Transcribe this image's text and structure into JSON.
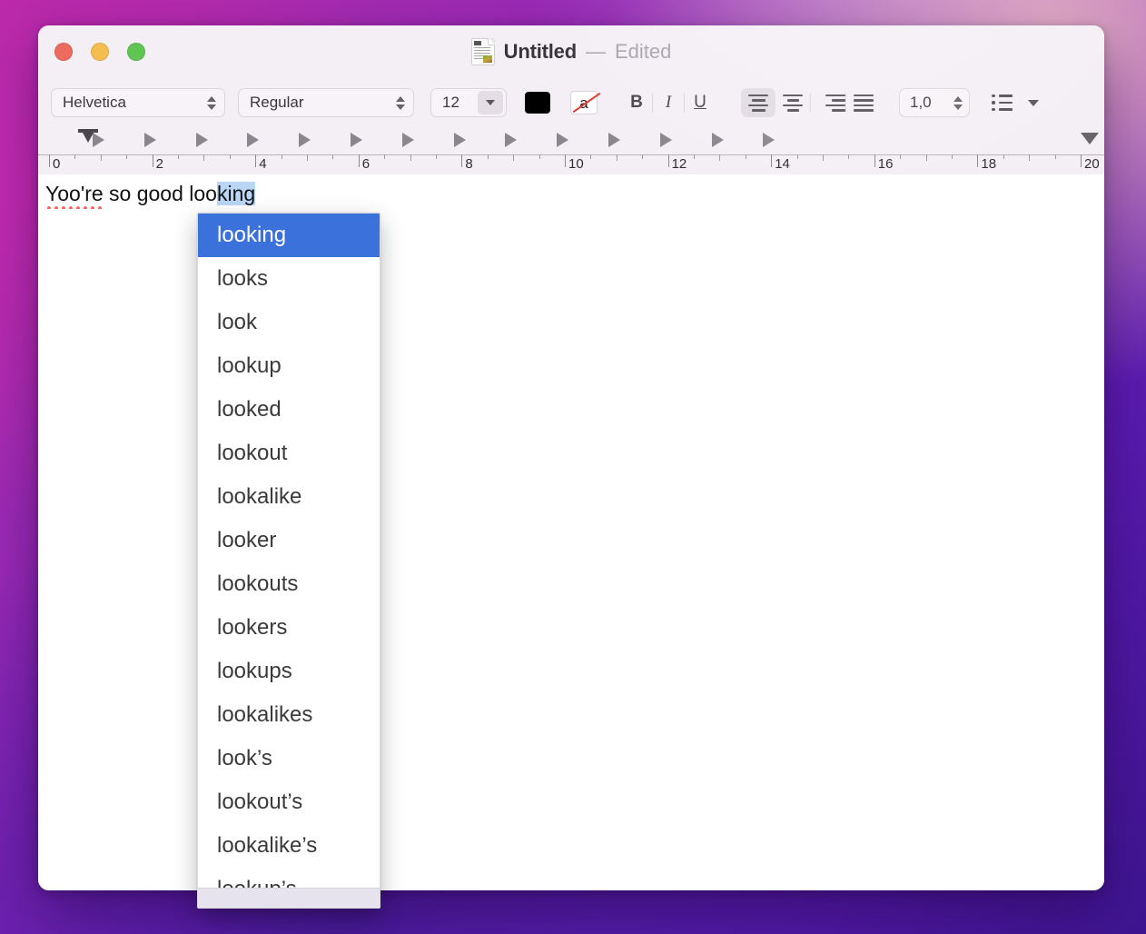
{
  "window": {
    "title": "Untitled",
    "separator": "—",
    "edited_label": "Edited",
    "doc_icon": "textedit-document-icon",
    "traffic_lights": {
      "close": "close-button",
      "minimize": "minimize-button",
      "zoom": "zoom-button"
    }
  },
  "toolbar": {
    "font_family": "Helvetica",
    "font_style": "Regular",
    "font_size": "12",
    "text_color": "#000000",
    "highlight_label": "a",
    "bold_label": "B",
    "italic_label": "I",
    "underline_label": "U",
    "line_spacing": "1,0",
    "active_alignment": "left",
    "accent_selected": "#e2dbe4"
  },
  "ruler": {
    "unit_labels": [
      "0",
      "2",
      "4",
      "6",
      "8",
      "10",
      "12",
      "14",
      "16",
      "18",
      "20"
    ],
    "max_unit": 20,
    "left_indent": "left-indent-marker",
    "right_indent": "right-indent-marker",
    "tab_stops": 14
  },
  "document": {
    "text_before": "Yoo",
    "misspelled_word": "Yoo're",
    "full_text": "Yoo're so good looking",
    "segment_plain": "Yoo're so good loo",
    "segment_selected": "king",
    "selection_color": "#b9d6f7",
    "spellcheck_underline_color": "#f1665e"
  },
  "suggestions": {
    "selected_index": 0,
    "selected_color": "#3a71da",
    "items": [
      "looking",
      "looks",
      "look",
      "lookup",
      "looked",
      "lookout",
      "lookalike",
      "looker",
      "lookouts",
      "lookers",
      "lookups",
      "lookalikes",
      "look’s",
      "lookout’s",
      "lookalike’s",
      "lookup’s"
    ]
  }
}
